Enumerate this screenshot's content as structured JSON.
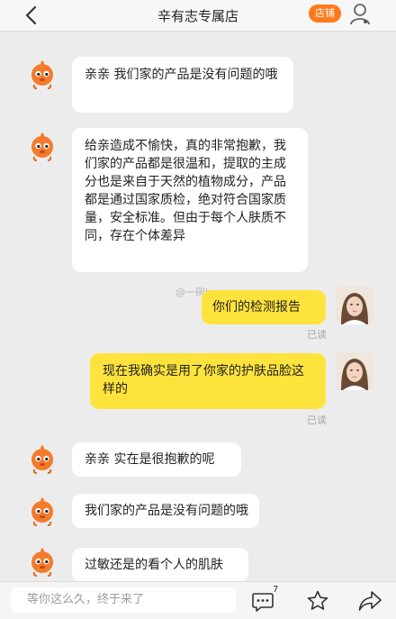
{
  "header": {
    "title": "辛有志专属店",
    "shop_badge": "店铺"
  },
  "watermark": "@一碗hu",
  "messages": [
    {
      "side": "left",
      "text": "亲亲   我们家的产品是没有问题的哦"
    },
    {
      "side": "left",
      "text": "给亲造成不愉快，真的非常抱歉，我们家的产品都是很温和，提取的主成分也是来自于天然的植物成分，产品都是通过国家质检，绝对符合国家质量，安全标准。但由于每个人肤质不同，存在个体差异"
    },
    {
      "side": "right",
      "text": "你们的检测报告",
      "status": "已读"
    },
    {
      "side": "right",
      "text": "现在我确实是用了你家的护肤品脸这样的",
      "status": "已读"
    },
    {
      "side": "left",
      "text": "亲亲 实在是很抱歉的呢"
    },
    {
      "side": "left",
      "text": "我们家的产品是没有问题的哦"
    },
    {
      "side": "left",
      "text": "过敏还是的看个人的肌肤"
    }
  ],
  "bottom_bar": {
    "input_placeholder": "等你这么久，终于来了",
    "comment_count": "7"
  },
  "colors": {
    "shop_badge": "#ff7a1a",
    "right_bubble": "#ffe33d",
    "left_bubble": "#ffffff",
    "background": "#ececec"
  },
  "icons": [
    "back-icon",
    "person-icon",
    "shop-mascot-avatar",
    "user-avatar",
    "comment-icon",
    "star-icon",
    "share-icon"
  ]
}
